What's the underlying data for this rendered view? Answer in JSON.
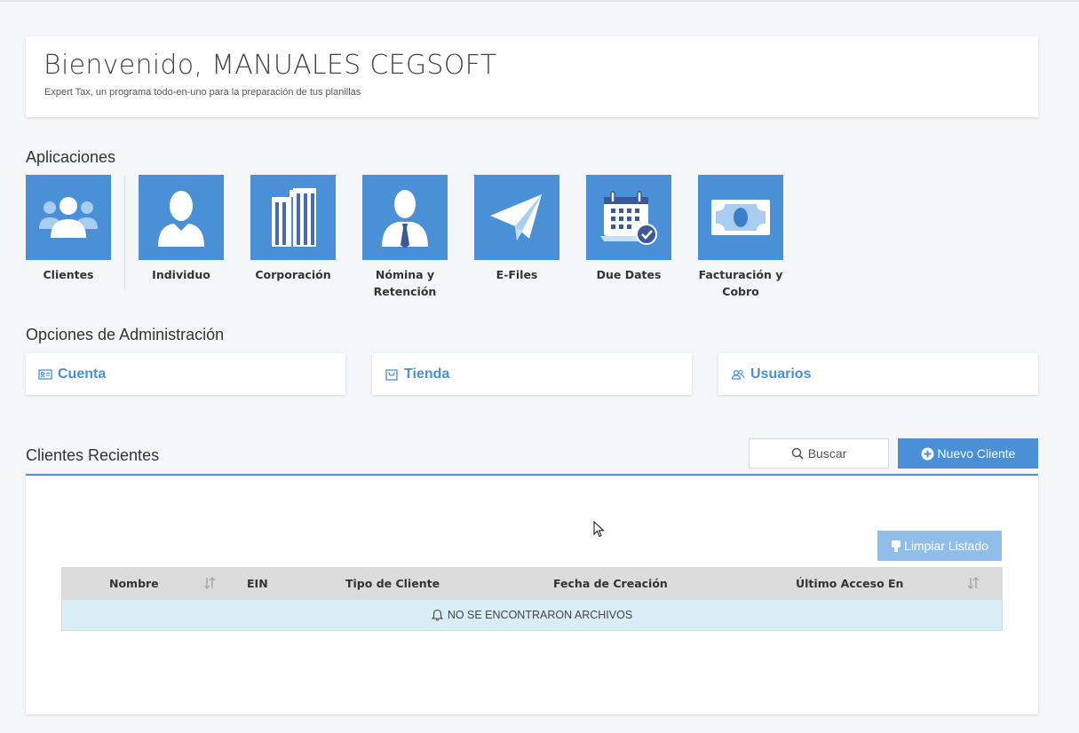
{
  "welcome": {
    "title": "Bienvenido, MANUALES CEGSOFT",
    "subtitle": "Expert Tax, un programa todo-en-uno para la preparación de tus planillas"
  },
  "applications": {
    "title": "Aplicaciones",
    "items": [
      {
        "label": "Clientes",
        "icon": "users-icon"
      },
      {
        "label": "Individuo",
        "icon": "person-icon"
      },
      {
        "label": "Corporación",
        "icon": "buildings-icon"
      },
      {
        "label": "Nómina y Retención",
        "icon": "businessman-icon"
      },
      {
        "label": "E-Files",
        "icon": "paper-plane-icon"
      },
      {
        "label": "Due Dates",
        "icon": "calendar-check-icon"
      },
      {
        "label": "Facturación y Cobro",
        "icon": "banknote-icon"
      }
    ]
  },
  "admin": {
    "title": "Opciones de Administración",
    "items": [
      {
        "label": "Cuenta",
        "icon": "id-card-icon"
      },
      {
        "label": "Tienda",
        "icon": "shopping-bag-icon"
      },
      {
        "label": "Usuarios",
        "icon": "users-outline-icon"
      }
    ]
  },
  "recent": {
    "title": "Clientes Recientes",
    "search_label": "Buscar",
    "new_label": "Nuevo Cliente",
    "clear_label": "Limpiar Listado",
    "columns": [
      "Nombre",
      "EIN",
      "Tipo de Cliente",
      "Fecha de Creación",
      "Último Acceso En"
    ],
    "empty_message": "NO SE ENCONTRARON ARCHIVOS"
  },
  "colors": {
    "accent": "#4a90d6",
    "accent_light": "#91bde9",
    "empty_row": "#d9edf5"
  }
}
